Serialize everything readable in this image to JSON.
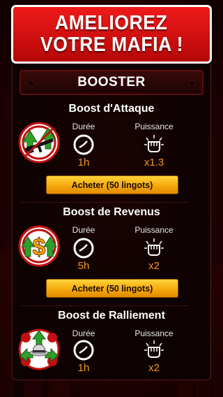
{
  "banner": {
    "line1": "AMELIOREZ",
    "line2": "VOTRE MAFIA !"
  },
  "booster_header": "BOOSTER",
  "labels": {
    "duration": "Durée",
    "power": "Puissance"
  },
  "boosts": [
    {
      "title": "Boost d'Attaque",
      "duration": "1h",
      "power": "x1.3",
      "button": "Acheter (50 lingots)",
      "icon": "rifle-icon"
    },
    {
      "title": "Boost de Revenus",
      "duration": "5h",
      "power": "x2",
      "button": "Acheter (50 lingots)",
      "icon": "dollar-icon"
    },
    {
      "title": "Boost de Ralliement",
      "duration": "1h",
      "power": "x2",
      "button": "Acheter (50 lingots)",
      "icon": "fedora-icon"
    }
  ],
  "colors": {
    "accent": "#f29a1b",
    "banner": "#e01010",
    "button": "#f6a90d"
  }
}
